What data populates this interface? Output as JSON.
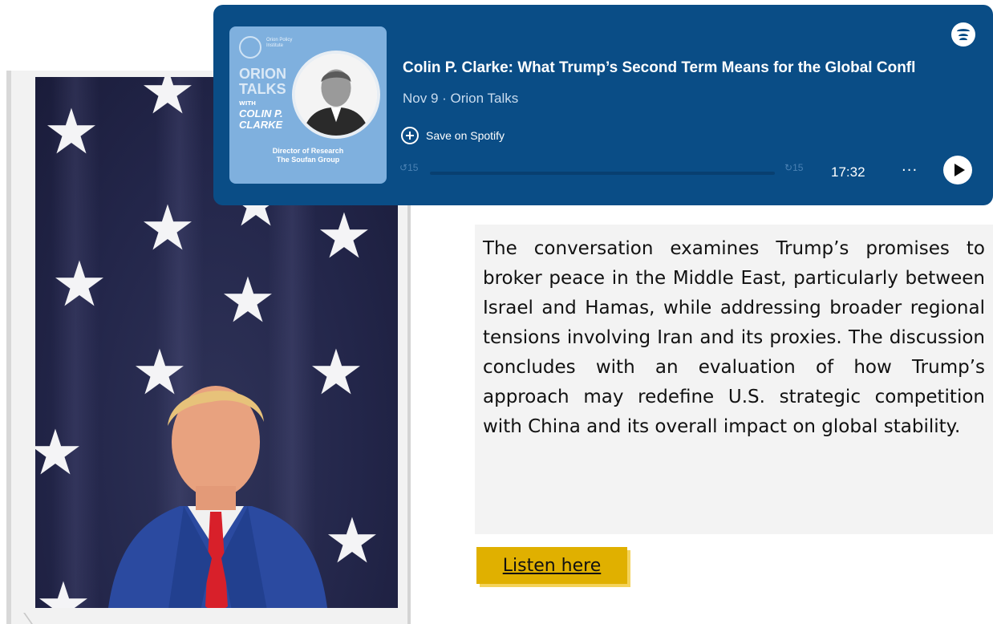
{
  "podcast": {
    "cover": {
      "org_name": "Orion Policy Institute",
      "show_title": "ORION TALKS",
      "with_label": "WITH",
      "guest_name": "COLIN P. CLARKE",
      "role_line1": "Director of Research",
      "role_line2": "The Soufan Group"
    },
    "episode_title": "Colin P. Clarke: What Trump’s Second Term Means for the Global Confl",
    "meta": "Nov 9 · Orion Talks",
    "save_label": "Save on Spotify",
    "skip_back_label": "15",
    "skip_forward_label": "15",
    "progress": 0.0,
    "duration": "17:32",
    "more_label": "···",
    "icons": [
      "spotify-logo-icon",
      "add-circle-icon",
      "skip-back-15-icon",
      "skip-forward-15-icon",
      "more-icon",
      "play-icon"
    ]
  },
  "article": {
    "description": "The conversation examines Trump’s promises to broker peace in the Middle East, particularly between Israel and Hamas, while addressing broader regional tensions involving Iran and its proxies. The discussion concludes with an evaluation of how Trump’s approach may redefine U.S. strategic competition with China and its overall impact on global stability.",
    "listen_label": "Listen here"
  },
  "colors": {
    "embed_bg": "#0a4d86",
    "button_bg": "#e0b000",
    "text_box_bg": "#f3f3f3"
  }
}
